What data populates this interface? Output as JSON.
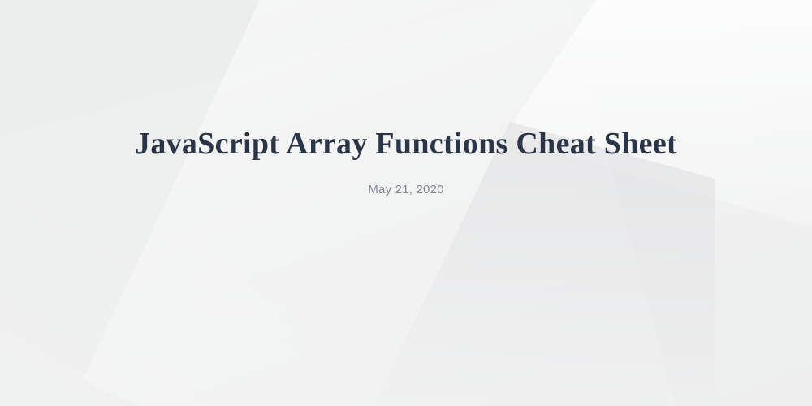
{
  "header": {
    "title": "JavaScript Array Functions Cheat Sheet",
    "date": "May 21, 2020"
  }
}
